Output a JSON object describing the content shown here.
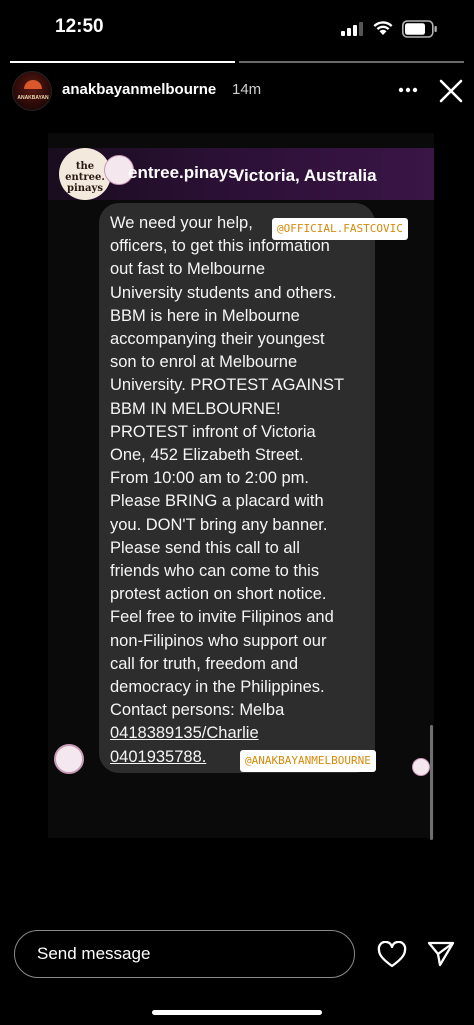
{
  "status_bar": {
    "time": "12:50"
  },
  "story": {
    "progress_segments": 2,
    "progress_active_index": 0,
    "username": "anakbayanmelbourne",
    "time_ago": "14m",
    "avatar_text": "ANAKBAYAN"
  },
  "shared_post": {
    "logo_text": "the entree. pinays",
    "account_name": "entree.pinays",
    "location": "Victoria, Australia",
    "message_lines": [
      "We need your help,",
      "officers, to get this information",
      "out fast to Melbourne",
      "University students and others.",
      "BBM is here in Melbourne",
      "accompanying their youngest",
      "son to enrol at Melbourne",
      "University. PROTEST AGAINST",
      "BBM IN MELBOURNE!",
      "PROTEST infront of Victoria",
      "One, 452 Elizabeth Street.",
      "From 10:00 am to 2:00 pm.",
      "Please BRING a placard with",
      "you.  DON'T bring any banner.",
      "Please send this call to all",
      "friends who can come to this",
      "protest action on short notice.",
      "Feel free to invite Filipinos and",
      "non-Filipinos who support our",
      "call for truth, freedom and",
      "democracy in the Philippines.",
      "Contact persons: Melba",
      "0418389135/Charlie",
      "0401935788."
    ],
    "tag_top": "@OFFICIAL.FASTCOVIC",
    "tag_bottom": "@ANAKBAYANMELBOURNE"
  },
  "reply": {
    "placeholder": "Send message"
  },
  "icons": {
    "more": "more-icon",
    "close": "close-icon",
    "heart": "heart-icon",
    "send": "send-icon",
    "signal": "signal-icon",
    "wifi": "wifi-icon",
    "battery": "battery-icon"
  },
  "colors": {
    "background": "#000000",
    "bubble": "#2d2d2d",
    "tag_text": "#d58a0a",
    "banner_purple": "#3a1547"
  }
}
